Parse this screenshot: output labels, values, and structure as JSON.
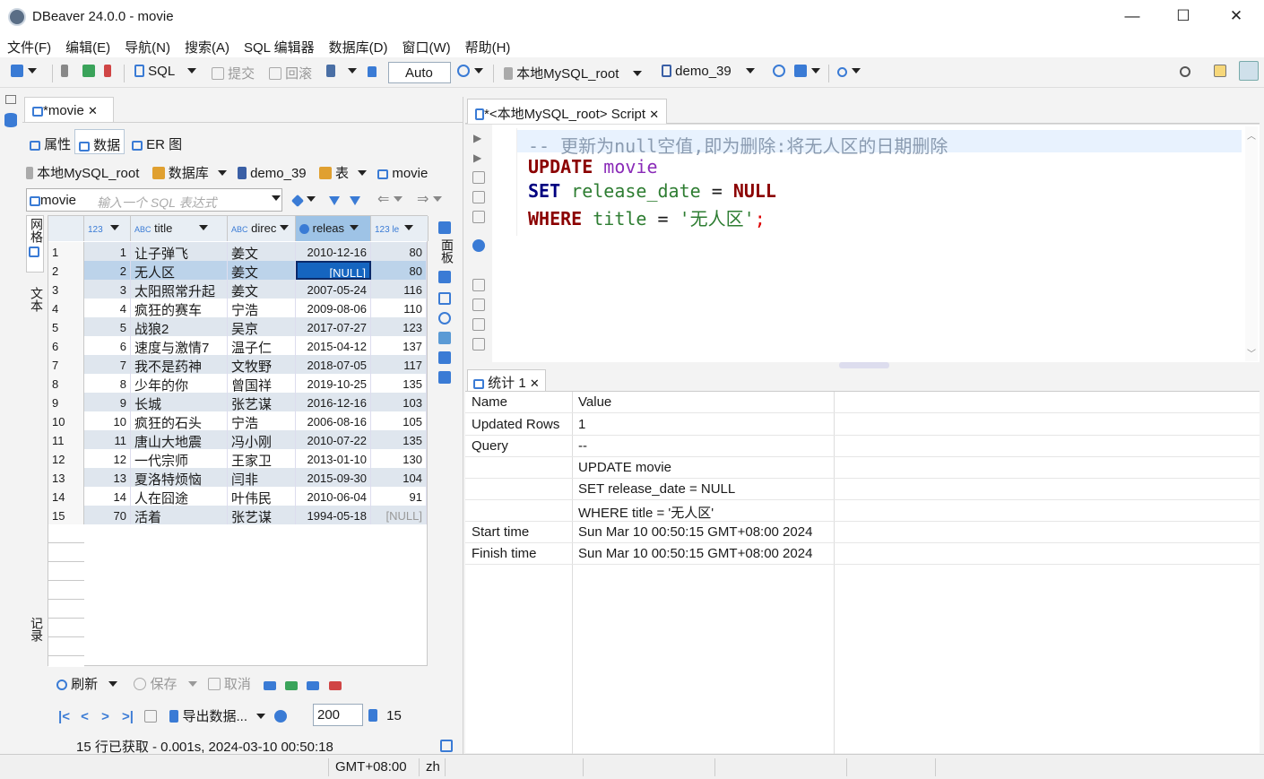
{
  "window": {
    "title": "DBeaver 24.0.0 - movie",
    "minimize": "—",
    "maximize": "☐",
    "close": "✕"
  },
  "menu": [
    "文件(F)",
    "编辑(E)",
    "导航(N)",
    "搜索(A)",
    "SQL 编辑器",
    "数据库(D)",
    "窗口(W)",
    "帮助(H)"
  ],
  "toolbar": {
    "sql": "SQL",
    "commit": "提交",
    "rollback": "回滚",
    "txmode": "Auto",
    "connection": "本地MySQL_root",
    "database": "demo_39"
  },
  "left": {
    "tab": "*movie",
    "subtabs": [
      "属性",
      "数据",
      "ER 图"
    ],
    "breadcrumb": {
      "conn": "本地MySQL_root",
      "db": "数据库",
      "schema": "demo_39",
      "tables": "表",
      "table": "movie"
    },
    "filter": {
      "table": "movie",
      "placeholder": "输入一个 SQL 表达式"
    },
    "columns": [
      "123",
      "title",
      "direc",
      "releas",
      "123 le"
    ],
    "rows": [
      {
        "n": "1",
        "id": "1",
        "title": "让子弹飞",
        "dir": "姜文",
        "date": "2010-12-16",
        "len": "80"
      },
      {
        "n": "2",
        "id": "2",
        "title": "无人区",
        "dir": "姜文",
        "date": "[NULL]",
        "len": "80"
      },
      {
        "n": "3",
        "id": "3",
        "title": "太阳照常升起",
        "dir": "姜文",
        "date": "2007-05-24",
        "len": "116"
      },
      {
        "n": "4",
        "id": "4",
        "title": "疯狂的赛车",
        "dir": "宁浩",
        "date": "2009-08-06",
        "len": "110"
      },
      {
        "n": "5",
        "id": "5",
        "title": "战狼2",
        "dir": "吴京",
        "date": "2017-07-27",
        "len": "123"
      },
      {
        "n": "6",
        "id": "6",
        "title": "速度与激情7",
        "dir": "温子仁",
        "date": "2015-04-12",
        "len": "137"
      },
      {
        "n": "7",
        "id": "7",
        "title": "我不是药神",
        "dir": "文牧野",
        "date": "2018-07-05",
        "len": "117"
      },
      {
        "n": "8",
        "id": "8",
        "title": "少年的你",
        "dir": "曾国祥",
        "date": "2019-10-25",
        "len": "135"
      },
      {
        "n": "9",
        "id": "9",
        "title": "长城",
        "dir": "张艺谋",
        "date": "2016-12-16",
        "len": "103"
      },
      {
        "n": "10",
        "id": "10",
        "title": "疯狂的石头",
        "dir": "宁浩",
        "date": "2006-08-16",
        "len": "105"
      },
      {
        "n": "11",
        "id": "11",
        "title": "唐山大地震",
        "dir": "冯小刚",
        "date": "2010-07-22",
        "len": "135"
      },
      {
        "n": "12",
        "id": "12",
        "title": "一代宗师",
        "dir": "王家卫",
        "date": "2013-01-10",
        "len": "130"
      },
      {
        "n": "13",
        "id": "13",
        "title": "夏洛特烦恼",
        "dir": "闫非",
        "date": "2015-09-30",
        "len": "104"
      },
      {
        "n": "14",
        "id": "14",
        "title": "人在囧途",
        "dir": "叶伟民",
        "date": "2010-06-04",
        "len": "91"
      },
      {
        "n": "15",
        "id": "70",
        "title": "活着",
        "dir": "张艺谋",
        "date": "1994-05-18",
        "len": "[NULL]"
      }
    ],
    "vtabs": [
      "网格",
      "文本",
      "记录"
    ],
    "panel_tab": "面板",
    "bottom": {
      "refresh": "刷新",
      "save": "保存",
      "cancel": "取消",
      "export": "导出数据...",
      "limit": "200",
      "count": "15",
      "status": "15 行已获取 - 0.001s, 2024-03-10 00:50:18"
    }
  },
  "editor": {
    "tab": "*<本地MySQL_root> Script",
    "lines": {
      "l1": "-- 更新为null空值,即为删除:将无人区的日期删除",
      "l2a": "UPDATE",
      "l2b": "movie",
      "l3a": "SET",
      "l3b": "release_date",
      "l3c": "=",
      "l3d": "NULL",
      "l4a": "WHERE",
      "l4b": "title",
      "l4c": "=",
      "l4d": "'无人区'",
      "l4e": ";"
    }
  },
  "results": {
    "tab": "统计 1",
    "header": {
      "k": "Name",
      "v": "Value"
    },
    "rows": [
      {
        "k": "Updated Rows",
        "v": "1"
      },
      {
        "k": "Query",
        "v": "--"
      },
      {
        "k": "",
        "v": "UPDATE movie"
      },
      {
        "k": "",
        "v": "SET release_date = NULL"
      },
      {
        "k": "",
        "v": "WHERE title = '无人区'"
      },
      {
        "k": "Start time",
        "v": "Sun Mar 10 00:50:15 GMT+08:00 2024"
      },
      {
        "k": "Finish time",
        "v": "Sun Mar 10 00:50:15 GMT+08:00 2024"
      }
    ]
  },
  "statusbar": {
    "tz": "GMT+08:00",
    "lang": "zh"
  }
}
